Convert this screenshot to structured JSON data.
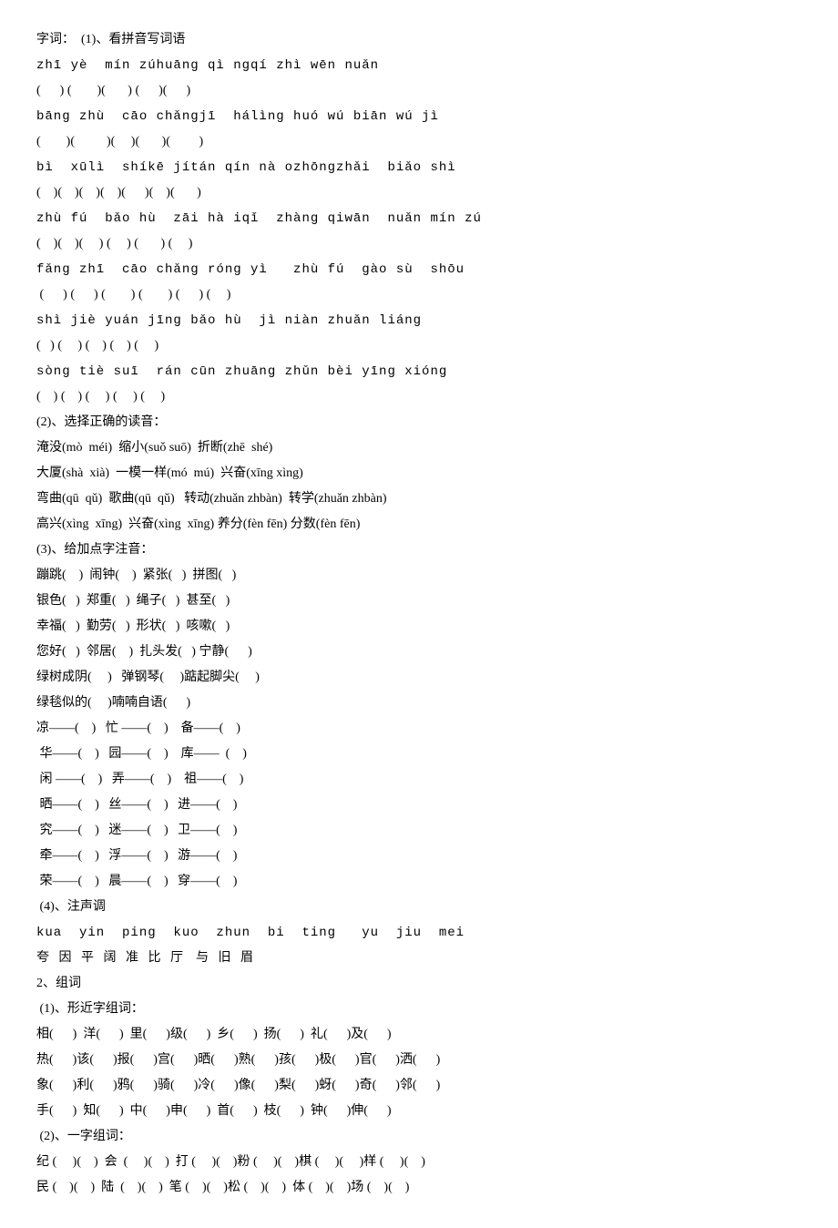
{
  "title": "字词：  (1)、看拼音写词语",
  "section1": {
    "pinyin_rows": [
      "zhī yè  mín zúhuāng qì ngqí zhì wēn nuǎn",
      "(      ) (        )(       ) (      )(      )",
      "bāng zhù  cāo chǎngjī  hálìng huó wú biān wú jì",
      "(        )(          )(     )(       )(         )",
      "bì  xūlì  shíkē jítán qín nà ozhōngzhǎi  biǎo shì",
      "(    )(    )(    )(    )(      )(    )(       )",
      "zhù fú  bǎo hù  zāi hà iqǐ  zhàng qiwān  nuǎn mín zú",
      "(    )(    )(     ) (     ) (       ) (     )",
      "fǎng zhī  cāo chǎng róng yì   zhù fú  gào sù  shōu",
      " (      ) (      ) (        ) (        ) (      ) (     )",
      "shì jiè yuán jīng bǎo hù  jì niàn zhuǎn liáng",
      "(   ) (     ) (    ) (    ) (     )",
      "sòng tiè suī  rán cūn zhuāng zhǔn bèi yīng xióng",
      "(    ) (    ) (     ) (     ) (     )"
    ]
  },
  "section2": {
    "heading": "(2)、选择正确的读音：",
    "items": [
      "淹没(mò  méi)  缩小(suǒ suō)  折断(zhē  shé)",
      "大厦(shà  xià)  一模一样(mó  mú)  兴奋(xīng xìng)",
      "弯曲(qū  qǔ)  歌曲(qū  qǔ)   转动(zhuǎn zhbàn)  转学(zhuǎn zhbàn)",
      "高兴(xìng  xīng)  兴奋(xìng  xīng) 养分(fèn fēn) 分数(fèn fēn)"
    ]
  },
  "section3": {
    "heading": "(3)、给加点字注音：",
    "items": [
      "蹦跳(    )  闹钟(    )  紧张(   )  拼图(   )",
      "银色(   )  郑重(   )  绳子(   )  甚至(   )",
      "幸福(   )  勤劳(   )  形状(   )  咳嗽(   )",
      "您好(   )  邻居(    )  扎头发(   ) 宁静(      )",
      "绿树成阴(     )   弹钢琴(     )踮起脚尖(     )",
      "绿毯似的(     )喃喃自语(      )",
      "凉——(    )   忙 ——(    )    备——(    )",
      " 华——(    )   园——(    )    库——  (    )",
      " 闲 ——(    )   弄——(    )    祖——(    )",
      " 晒——(    )   丝——(    )   进——(    )",
      " 究——(    )   迷——(    )   卫——(    )",
      " 牵——(    )   浮——(    )   游——(    )",
      " 荣——(    )   晨——(    )   穿——(    )"
    ]
  },
  "section4": {
    "heading": " (4)、注声调",
    "pinyin": "kua  yin  ping  kuo  zhun  bi  ting   yu  jiu  mei",
    "chars": "夸   因   平   阔   准   比   厅    与   旧   眉"
  },
  "section5": {
    "heading": "2、组词",
    "sub1_heading": " (1)、形近字组词：",
    "sub1_rows": [
      "相(      )  洋(      )  里(      )级(      )  乡(      )  扬(      )  礼(      )及(      )",
      "热(      )该(      )报(      )宫(      )晒(      )熟(      )孩(      )极(      )官(      )洒(      )",
      "象(      )利(      )鸦(      )骑(      )冷(      )像(      )梨(      )蚜(      )奇(      )邻(      )",
      "手(      )  知(      )  中(      )申(      )  首(      )  枝(      )  钟(      )伸(      )"
    ],
    "sub2_heading": " (2)、一字组词：",
    "sub2_rows": [
      "纪 (     )(    )  会  (     )(    )  打 (     )(    )粉 (     )(    )棋 (     )(     )样 (     )(    )",
      "民 (    )(    )  陆  (    )(    )  笔 (    )(    )松 (    )(    )  体 (    )(    )场 (    )(    )"
    ]
  }
}
